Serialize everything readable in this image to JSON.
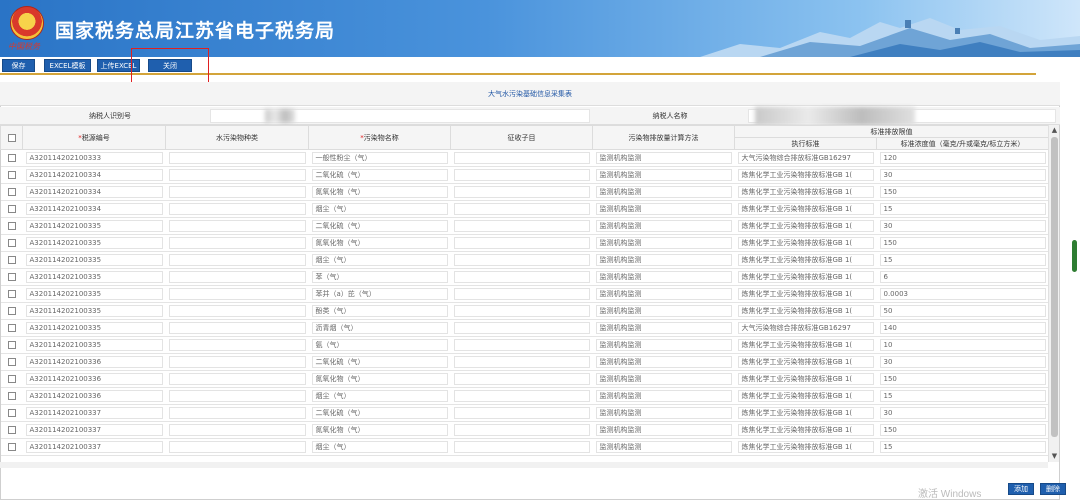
{
  "header": {
    "title": "国家税务总局江苏省电子税务局",
    "emblem_caption": "中国税务",
    "banner_colors": {
      "start": "#2a74c6",
      "end": "#cfe6fa"
    }
  },
  "toolbar": {
    "save": "保存",
    "excel_template": "EXCEL模板",
    "upload_excel": "上传EXCEL",
    "close": "关闭"
  },
  "form": {
    "title": "大气水污染基础信息采集表",
    "taxpayer_id_label": "纳税人识别号",
    "taxpayer_name_label": "纳税人名称"
  },
  "table": {
    "headers": {
      "tax_source_no": "税源编号",
      "water_pollutant_type": "水污染物种类",
      "pollutant_name": "污染物名称",
      "tax_sub_item": "征收子目",
      "calc_method": "污染物排放量计算方法",
      "emission_limit_group": "标准排放限值",
      "exec_standard": "执行标准",
      "standard_concentration": "标准浓度值（毫克/升或毫克/标立方米）"
    },
    "rows": [
      {
        "no": "A320114202100333",
        "pollutant": "一般性粉尘（气）",
        "method": "监测机构监测",
        "standard": "大气污染物综合排放标准GB16297",
        "value": "120"
      },
      {
        "no": "A320114202100334",
        "pollutant": "二氧化硫（气）",
        "method": "监测机构监测",
        "standard": "炼焦化学工业污染物排放标准GB 1(",
        "value": "30"
      },
      {
        "no": "A320114202100334",
        "pollutant": "氮氧化物（气）",
        "method": "监测机构监测",
        "standard": "炼焦化学工业污染物排放标准GB 1(",
        "value": "150"
      },
      {
        "no": "A320114202100334",
        "pollutant": "烟尘（气）",
        "method": "监测机构监测",
        "standard": "炼焦化学工业污染物排放标准GB 1(",
        "value": "15"
      },
      {
        "no": "A320114202100335",
        "pollutant": "二氧化硫（气）",
        "method": "监测机构监测",
        "standard": "炼焦化学工业污染物排放标准GB 1(",
        "value": "30"
      },
      {
        "no": "A320114202100335",
        "pollutant": "氮氧化物（气）",
        "method": "监测机构监测",
        "standard": "炼焦化学工业污染物排放标准GB 1(",
        "value": "150"
      },
      {
        "no": "A320114202100335",
        "pollutant": "烟尘（气）",
        "method": "监测机构监测",
        "standard": "炼焦化学工业污染物排放标准GB 1(",
        "value": "15"
      },
      {
        "no": "A320114202100335",
        "pollutant": "苯（气）",
        "method": "监测机构监测",
        "standard": "炼焦化学工业污染物排放标准GB 1(",
        "value": "6"
      },
      {
        "no": "A320114202100335",
        "pollutant": "苯并（a）芘（气）",
        "method": "监测机构监测",
        "standard": "炼焦化学工业污染物排放标准GB 1(",
        "value": "0.0003"
      },
      {
        "no": "A320114202100335",
        "pollutant": "酚类（气）",
        "method": "监测机构监测",
        "standard": "炼焦化学工业污染物排放标准GB 1(",
        "value": "50"
      },
      {
        "no": "A320114202100335",
        "pollutant": "沥青烟（气）",
        "method": "监测机构监测",
        "standard": "大气污染物综合排放标准GB16297",
        "value": "140"
      },
      {
        "no": "A320114202100335",
        "pollutant": "氨（气）",
        "method": "监测机构监测",
        "standard": "炼焦化学工业污染物排放标准GB 1(",
        "value": "10"
      },
      {
        "no": "A320114202100336",
        "pollutant": "二氧化硫（气）",
        "method": "监测机构监测",
        "standard": "炼焦化学工业污染物排放标准GB 1(",
        "value": "30"
      },
      {
        "no": "A320114202100336",
        "pollutant": "氮氧化物（气）",
        "method": "监测机构监测",
        "standard": "炼焦化学工业污染物排放标准GB 1(",
        "value": "150"
      },
      {
        "no": "A320114202100336",
        "pollutant": "烟尘（气）",
        "method": "监测机构监测",
        "standard": "炼焦化学工业污染物排放标准GB 1(",
        "value": "15"
      },
      {
        "no": "A320114202100337",
        "pollutant": "二氧化硫（气）",
        "method": "监测机构监测",
        "standard": "炼焦化学工业污染物排放标准GB 1(",
        "value": "30"
      },
      {
        "no": "A320114202100337",
        "pollutant": "氮氧化物（气）",
        "method": "监测机构监测",
        "standard": "炼焦化学工业污染物排放标准GB 1(",
        "value": "150"
      },
      {
        "no": "A320114202100337",
        "pollutant": "烟尘（气）",
        "method": "监测机构监测",
        "standard": "炼焦化学工业污染物排放标准GB 1(",
        "value": "15"
      }
    ]
  },
  "footer": {
    "watermark": "激活 Windows",
    "add": "添加",
    "delete": "删除"
  }
}
